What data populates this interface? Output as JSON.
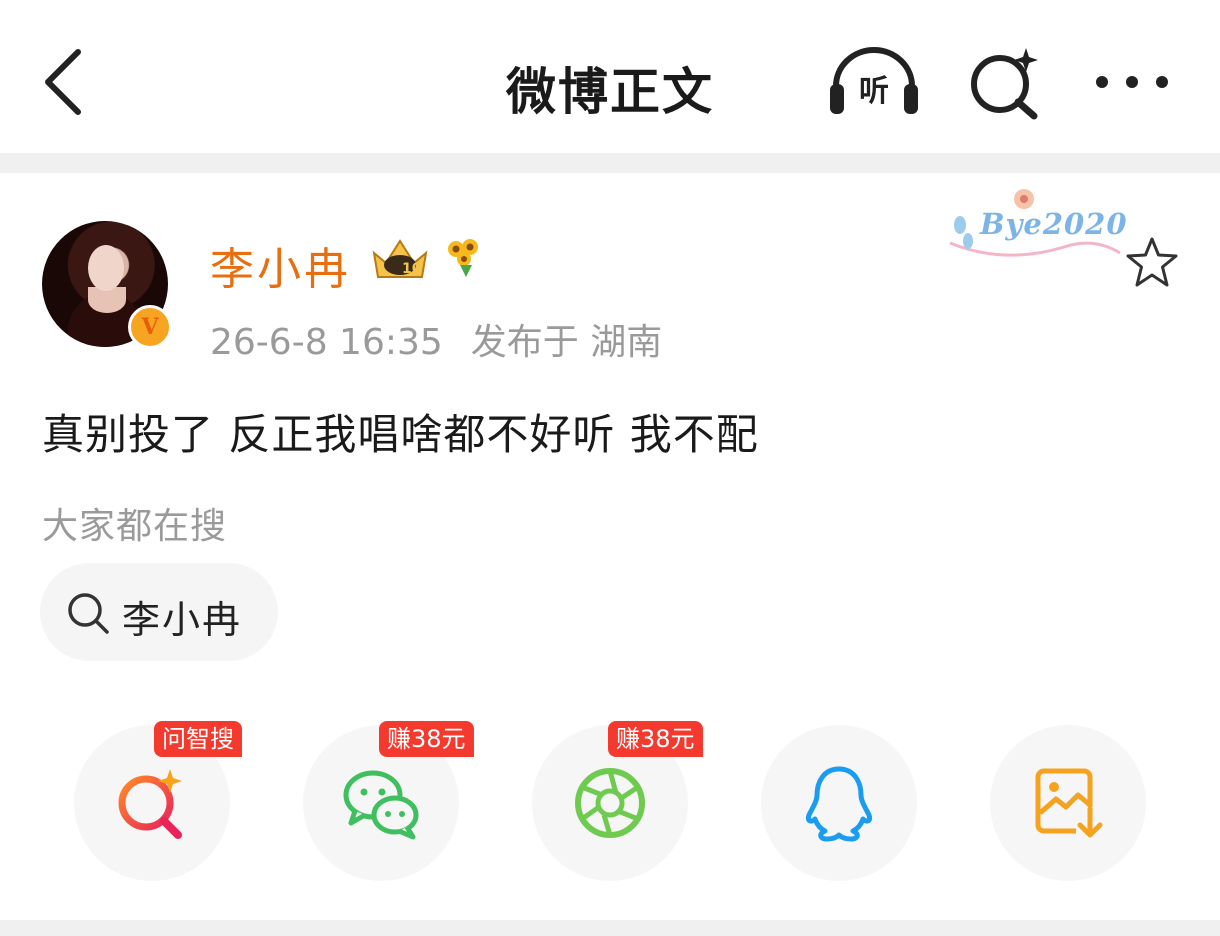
{
  "header": {
    "title": "微博正文",
    "listen_label": "听"
  },
  "post": {
    "author": "李小冉",
    "timestamp": "26-6-8 16:35",
    "location_text": "发布于 湖南",
    "verified_mark": "V",
    "decoration_text": "Bye2020",
    "content": "真别投了 反正我唱啥都不好听 我不配"
  },
  "hot_search": {
    "heading": "大家都在搜",
    "query": "李小冉"
  },
  "share": {
    "items": [
      {
        "name": "ai-search",
        "tag": "问智搜"
      },
      {
        "name": "wechat",
        "tag": "赚38元"
      },
      {
        "name": "moments",
        "tag": "赚38元"
      },
      {
        "name": "qq",
        "tag": ""
      },
      {
        "name": "save-image",
        "tag": ""
      }
    ]
  },
  "colors": {
    "accent_orange": "#e86e0f",
    "tag_red": "#f43a2e",
    "wechat_green": "#3fbf5f",
    "moments_green": "#6fcb4f",
    "qq_blue": "#1a9cf0",
    "save_orange": "#f5a21f"
  }
}
